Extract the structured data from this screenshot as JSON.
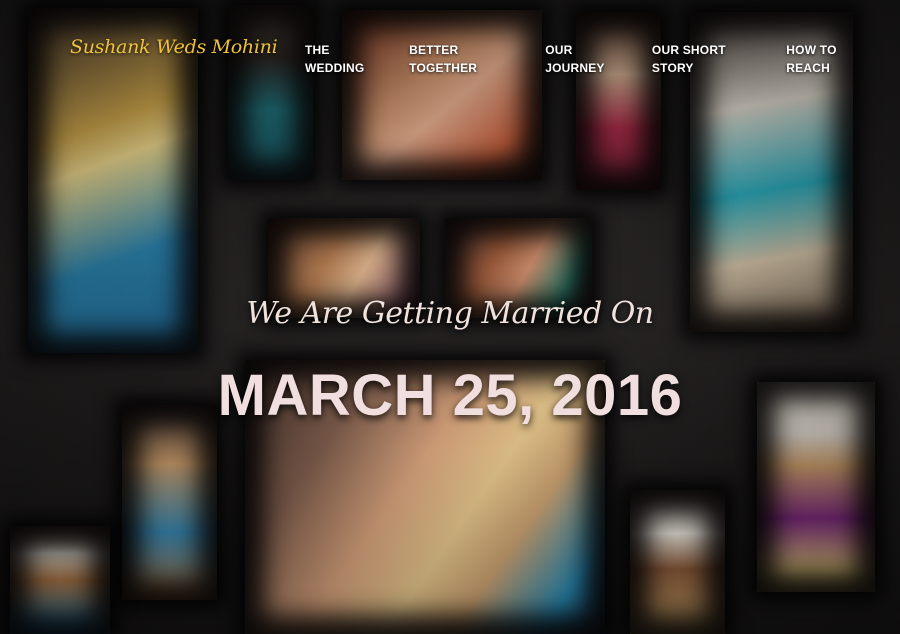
{
  "header": {
    "logo_text": "Sushank Weds Mohini",
    "nav": [
      {
        "label": "THE WEDDING"
      },
      {
        "label": "BETTER TOGETHER"
      },
      {
        "label": "OUR JOURNEY"
      },
      {
        "label": "OUR SHORT STORY"
      },
      {
        "label": "HOW TO REACH"
      }
    ]
  },
  "hero": {
    "tagline": "We Are Getting Married On",
    "date": "MARCH 25, 2016"
  },
  "colors": {
    "accent": "#f0c23a",
    "background": "#1c1a1a",
    "text": "#f1dede"
  }
}
